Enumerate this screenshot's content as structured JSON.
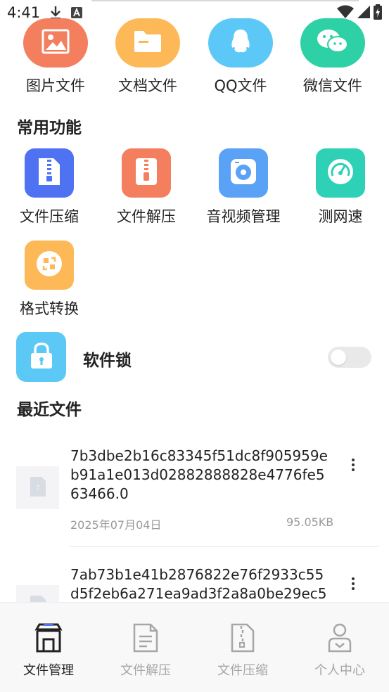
{
  "status_bar": {
    "time": "4:41"
  },
  "categories": [
    {
      "label": "图片文件",
      "icon": "image-icon",
      "color": "#f47f5f"
    },
    {
      "label": "文档文件",
      "icon": "folder-icon",
      "color": "#fdb957"
    },
    {
      "label": "QQ文件",
      "icon": "qq-icon",
      "color": "#5bc8f7"
    },
    {
      "label": "微信文件",
      "icon": "wechat-icon",
      "color": "#2ed0a6"
    }
  ],
  "common_functions": {
    "title": "常用功能",
    "items": [
      {
        "label": "文件压缩",
        "icon": "zip-file-icon",
        "color": "#4f72f2"
      },
      {
        "label": "文件解压",
        "icon": "unzip-file-icon",
        "color": "#f47f5f"
      },
      {
        "label": "音视频管理",
        "icon": "media-icon",
        "color": "#5aa2f5"
      },
      {
        "label": "测网速",
        "icon": "speedometer-icon",
        "color": "#2ed0b6"
      },
      {
        "label": "格式转换",
        "icon": "convert-icon",
        "color": "#fdb957"
      }
    ]
  },
  "software_lock": {
    "label": "软件锁",
    "enabled": false,
    "color": "#5bc8f5"
  },
  "recent_files": {
    "title": "最近文件",
    "items": [
      {
        "name": "7b3dbe2b16c83345f51dc8f905959eb91a1e013d02882888828e4776fe563466.0",
        "date": "2025年07月04日",
        "size": "95.05KB"
      },
      {
        "name": "7ab73b1e41b2876822e76f2933c55d5f2eb6a271ea9ad3f2a8a0be29ec5",
        "date": "",
        "size": ""
      }
    ]
  },
  "bottom_nav": {
    "items": [
      {
        "label": "文件管理",
        "icon": "store-icon",
        "active": true
      },
      {
        "label": "文件解压",
        "icon": "document-icon",
        "active": false
      },
      {
        "label": "文件压缩",
        "icon": "zip-document-icon",
        "active": false
      },
      {
        "label": "个人中心",
        "icon": "user-icon",
        "active": false
      }
    ]
  }
}
